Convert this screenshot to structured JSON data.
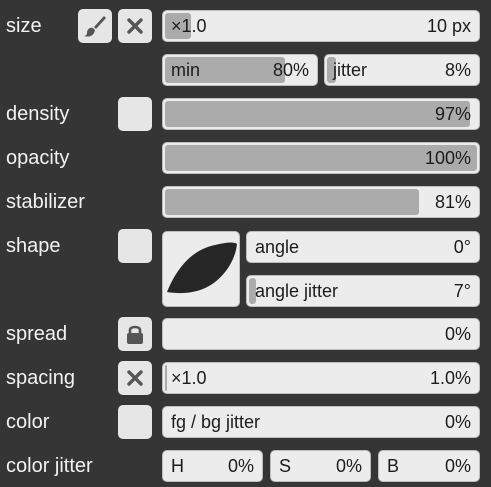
{
  "size": {
    "label": "size",
    "multiplier": "×1.0",
    "value": "10 px",
    "min_label": "min",
    "min_value": "80%",
    "min_fraction": 0.8,
    "jitter_label": "jitter",
    "jitter_value": "8%",
    "jitter_fraction": 0.08
  },
  "density": {
    "label": "density",
    "value": "97%",
    "fraction": 0.97
  },
  "opacity": {
    "label": "opacity",
    "value": "100%",
    "fraction": 1.0
  },
  "stabilizer": {
    "label": "stabilizer",
    "value": "81%",
    "fraction": 0.81
  },
  "shape": {
    "label": "shape",
    "angle_label": "angle",
    "angle_value": "0°",
    "angle_jitter_label": "angle jitter",
    "angle_jitter_value": "7°",
    "angle_jitter_fraction": 0.02
  },
  "spread": {
    "label": "spread",
    "value": "0%",
    "fraction": 0.0
  },
  "spacing": {
    "label": "spacing",
    "multiplier": "×1.0",
    "value": "1.0%",
    "fraction": 0.01
  },
  "color": {
    "label": "color",
    "fgbg_label": "fg / bg jitter",
    "fgbg_value": "0%"
  },
  "color_jitter": {
    "label": "color jitter",
    "h_label": "H",
    "h_value": "0%",
    "s_label": "S",
    "s_value": "0%",
    "b_label": "B",
    "b_value": "0%"
  },
  "colors": {
    "background": "#353535",
    "control": "#ececec",
    "fill": "#ababab",
    "label": "#f2f2f2"
  },
  "icons": [
    "brush-icon",
    "close-icon",
    "lock-icon"
  ]
}
